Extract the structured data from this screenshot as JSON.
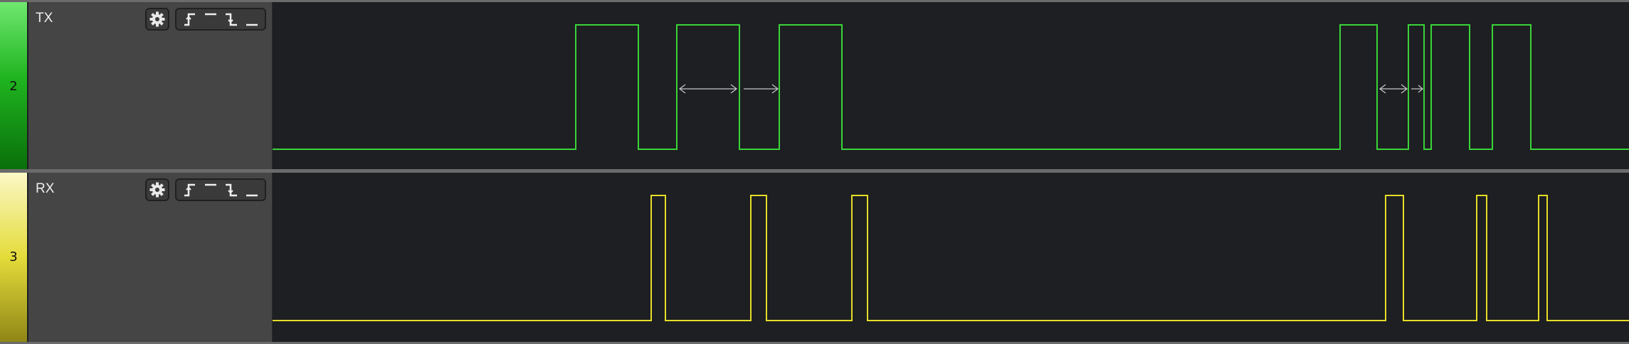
{
  "channels": [
    {
      "key": "tx",
      "number": "2",
      "name": "TX",
      "color": "#39d439",
      "strip": "green",
      "settings_icon": "gear-icon",
      "trigger_icons": [
        "rising-edge-icon",
        "high-level-icon",
        "falling-edge-icon",
        "low-level-icon"
      ]
    },
    {
      "key": "rx",
      "number": "3",
      "name": "RX",
      "color": "#e6dc28",
      "strip": "yellow",
      "settings_icon": "gear-icon",
      "trigger_icons": [
        "rising-edge-icon",
        "high-level-icon",
        "falling-edge-icon",
        "low-level-icon"
      ]
    }
  ]
}
